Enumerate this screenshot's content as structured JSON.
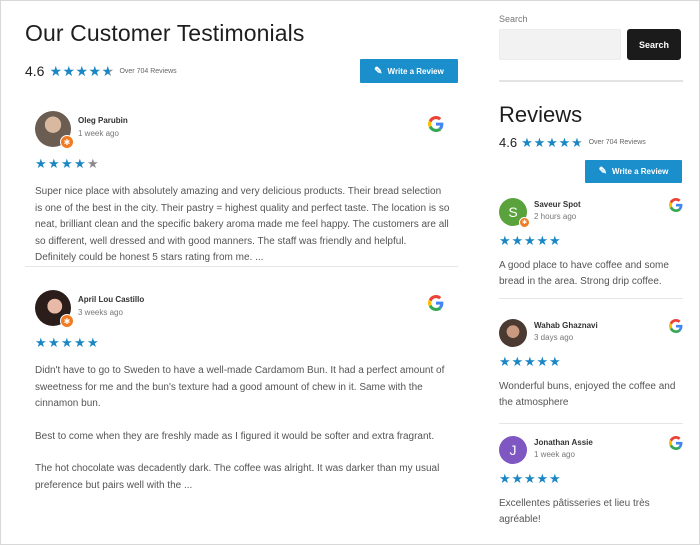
{
  "main": {
    "title": "Our Customer Testimonials",
    "rating": "4.6",
    "rating_stars": [
      1,
      1,
      1,
      1,
      0.6
    ],
    "review_count": "Over 704 Reviews",
    "write_review_label": "Write a Review"
  },
  "reviews": [
    {
      "name": "Oleg Parubin",
      "time": "1 week ago",
      "stars": [
        1,
        1,
        1,
        1,
        0
      ],
      "avatar_color": "#6b5d52",
      "paragraphs": [
        "Super nice place with absolutely amazing and very delicious products. Their bread selection is one of the best in the city. Their pastry = highest quality and perfect taste. The location is so neat, brilliant clean and the specific bakery aroma made me feel happy. The customers are all so different, well dressed and with good manners. The staff was friendly and helpful. Definitely could be honest 5 stars rating from me.  ..."
      ]
    },
    {
      "name": "April Lou Castillo",
      "time": "3 weeks ago",
      "stars": [
        1,
        1,
        1,
        1,
        1
      ],
      "avatar_color": "#3a2a26",
      "paragraphs": [
        "Didn't have to go to Sweden to have a well-made Cardamom Bun. It had a perfect amount of sweetness for me and the bun's texture had a good amount of chew in it. Same with the cinnamon bun.",
        "Best to come when they are freshly made as I figured it would be softer and extra fragrant.",
        "The hot chocolate was decadently dark. The coffee was alright. It was darker than my usual preference but pairs well with the  ..."
      ]
    }
  ],
  "sidebar": {
    "search_label": "Search",
    "search_placeholder": "",
    "search_button": "Search",
    "title": "Reviews",
    "rating": "4.6",
    "rating_stars": [
      1,
      1,
      1,
      1,
      0.6
    ],
    "review_count": "Over 704 Reviews",
    "write_review_label": "Write a Review",
    "reviews": [
      {
        "name": "Saveur Spot",
        "time": "2 hours ago",
        "initial": "S",
        "avatar_color": "#5aa33c",
        "stars": [
          1,
          1,
          1,
          1,
          1
        ],
        "text": "A good place to have coffee and some bread in the area. Strong drip coffee."
      },
      {
        "name": "Wahab Ghaznavi",
        "time": "3 days ago",
        "initial": "",
        "avatar_color": "#7a5a48",
        "stars": [
          1,
          1,
          1,
          1,
          1
        ],
        "text": "Wonderful buns, enjoyed the coffee and the atmosphere"
      },
      {
        "name": "Jonathan Assie",
        "time": "1 week ago",
        "initial": "J",
        "avatar_color": "#7e57c2",
        "stars": [
          1,
          1,
          1,
          1,
          1
        ],
        "text": "Excellentes pâtisseries et lieu très agréable!"
      }
    ]
  },
  "colors": {
    "accent": "#1a8fcc",
    "star": "#1a87c4",
    "badge": "#f07b22"
  }
}
